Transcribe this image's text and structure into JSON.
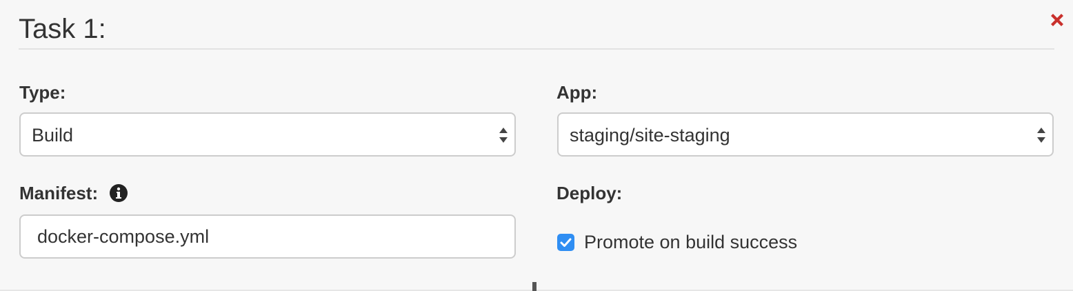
{
  "task": {
    "title": "Task 1:"
  },
  "form": {
    "type": {
      "label": "Type:",
      "value": "Build"
    },
    "app": {
      "label": "App:",
      "value": "staging/site-staging"
    },
    "manifest": {
      "label": "Manifest:",
      "value": "docker-compose.yml",
      "icon": "info-circle-icon"
    },
    "deploy": {
      "label": "Deploy:",
      "checkbox_label": "Promote on build success",
      "checked": true
    }
  },
  "colors": {
    "close": "#c9302c",
    "checkbox_accent": "#2f8ef3",
    "panel_bg": "#f7f7f7"
  },
  "icons": {
    "close": "close-icon",
    "select_arrows": "sort-arrows-icon",
    "check": "check-icon"
  }
}
